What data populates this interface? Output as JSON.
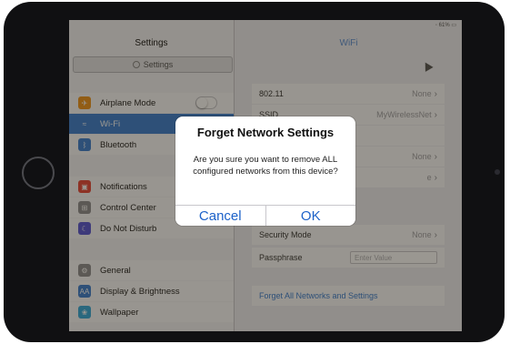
{
  "status": {
    "left": "▾",
    "right": "◦ 61% ▭"
  },
  "master": {
    "title": "Settings",
    "search_placeholder": "Settings",
    "items": [
      {
        "label": "Airplane Mode",
        "icon": "airplane-icon",
        "color": "#f0961e",
        "glyph": "✈"
      },
      {
        "label": "Wi-Fi",
        "icon": "wifi-icon",
        "color": "#3b7ed1",
        "glyph": "≈",
        "selected": true
      },
      {
        "label": "Bluetooth",
        "icon": "bluetooth-icon",
        "color": "#3b7ed1",
        "glyph": "ᛒ"
      },
      {
        "label": "Notifications",
        "icon": "notifications-icon",
        "color": "#e8473b",
        "glyph": "▣"
      },
      {
        "label": "Control Center",
        "icon": "control-center-icon",
        "color": "#8e8e93",
        "glyph": "⊞"
      },
      {
        "label": "Do Not Disturb",
        "icon": "moon-icon",
        "color": "#5856d6",
        "glyph": "☾"
      },
      {
        "label": "General",
        "icon": "gear-icon",
        "color": "#8e8e93",
        "glyph": "⚙"
      },
      {
        "label": "Display & Brightness",
        "icon": "display-icon",
        "color": "#3b7ed1",
        "glyph": "AA"
      },
      {
        "label": "Wallpaper",
        "icon": "wallpaper-icon",
        "color": "#34aadc",
        "glyph": "❀"
      }
    ]
  },
  "detail": {
    "title": "WiFi",
    "rows": {
      "r1": {
        "label": "802.11",
        "value": "None"
      },
      "r2": {
        "label": "SSID",
        "value": "MyWirelessNet"
      },
      "r3": {
        "label": "",
        "value": ""
      },
      "r4": {
        "label": "",
        "value": "None"
      },
      "r5": {
        "label": "",
        "value": "e"
      },
      "r6": {
        "label": "Security Mode",
        "value": "None"
      },
      "r7": {
        "label": "Passphrase",
        "placeholder": "Enter Value"
      },
      "forget": {
        "label": "Forget All Networks and Settings"
      }
    }
  },
  "alert": {
    "title": "Forget Network Settings",
    "message": "Are you sure you want to remove ALL configured networks from this device?",
    "cancel": "Cancel",
    "ok": "OK"
  }
}
